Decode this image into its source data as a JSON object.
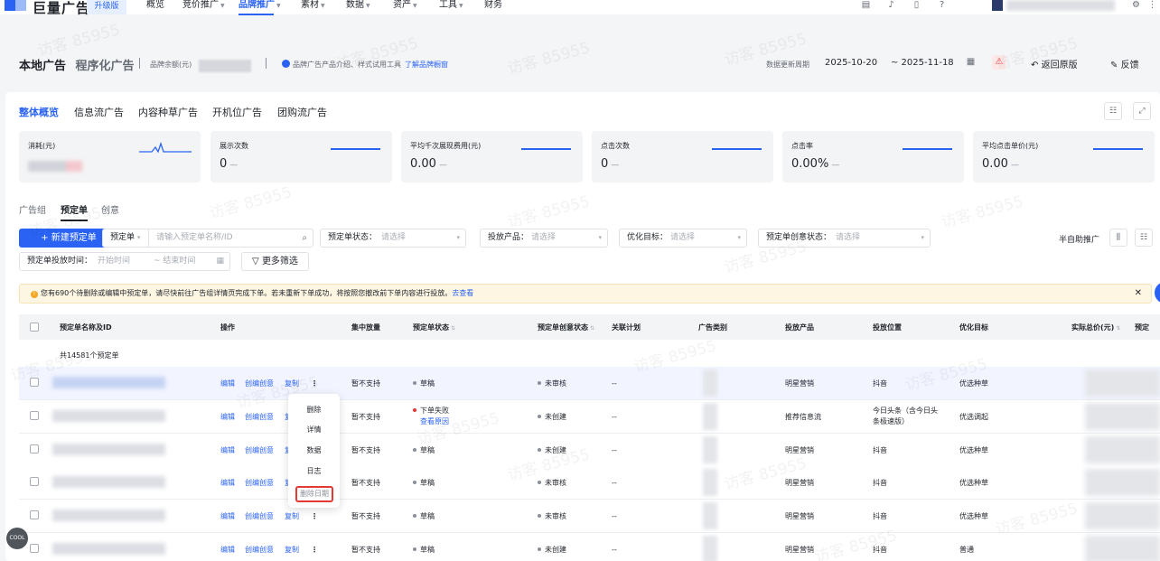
{
  "topnav": {
    "logo": "巨量广告",
    "badge": "升级版",
    "items": [
      {
        "label": "概览",
        "caret": false
      },
      {
        "label": "竞价推广",
        "caret": true
      },
      {
        "label": "品牌推广",
        "caret": true,
        "active": true
      },
      {
        "label": "素材",
        "caret": true
      },
      {
        "label": "数据",
        "caret": true
      },
      {
        "label": "资产",
        "caret": true
      },
      {
        "label": "工具",
        "caret": true
      },
      {
        "label": "财务",
        "caret": false
      }
    ],
    "caret_glyph": "▼"
  },
  "header": {
    "title": "本地广告",
    "subtitle": "程序化广告",
    "balance_label": "品牌余额(元)",
    "promo_text": "品牌广告产品介绍、样式试用工具",
    "promo_link": "了解品牌橱窗",
    "date_label": "数据更新周期",
    "date_start": "2025-10-20",
    "date_end": "~ 2025-11-18",
    "back_label": "返回原版",
    "feedback_label": "反馈"
  },
  "tabs": [
    "整体概览",
    "信息流广告",
    "内容种草广告",
    "开机位广告",
    "团购流广告"
  ],
  "metrics": [
    {
      "label": "消耗(元)",
      "value": "",
      "suffix": ""
    },
    {
      "label": "展示次数",
      "value": "0",
      "suffix": "—"
    },
    {
      "label": "平均千次展现费用(元)",
      "value": "0.00",
      "suffix": "—"
    },
    {
      "label": "点击次数",
      "value": "0",
      "suffix": "—"
    },
    {
      "label": "点击率",
      "value": "0.00%",
      "suffix": "—"
    },
    {
      "label": "平均点击单价(元)",
      "value": "0.00",
      "suffix": "—"
    }
  ],
  "subtabs": [
    "广告组",
    "预定单",
    "创意"
  ],
  "toolbar": {
    "new_button": "+ 新建预定单",
    "select_value": "预定单",
    "search_placeholder": "请输入预定单名称/ID",
    "filter_status_label": "预定单状态：",
    "filter_product_label": "投放产品：",
    "filter_goal_label": "优化目标：",
    "filter_creative_label": "预定单创意状态：",
    "placeholder": "请选择",
    "semi_auto": "半自助推广",
    "time_label": "预定单投放时间：",
    "time_start": "开始时间",
    "time_end": "~ 结束时间",
    "more_filters": "更多筛选"
  },
  "notice": {
    "text": "您有690个待删除或编辑中预定单，请尽快前往广告组详情页完成下单。若未重新下单成功，将按照您撤改前下单内容进行投放。",
    "link": "去查看"
  },
  "table": {
    "headers": [
      "预定单名称及ID",
      "操作",
      "集中放量",
      "预定单状态",
      "预定单创意状态",
      "关联计划",
      "广告类别",
      "投放产品",
      "投放位置",
      "优化目标",
      "实际总价(元)",
      "预定"
    ],
    "total": "共14581个预定单",
    "actions": {
      "edit": "编辑",
      "creative": "创编创意",
      "copy": "复制",
      "more": "⋮"
    },
    "rows": [
      {
        "concentrate": "暂不支持",
        "status": "草稿",
        "status_color": "gray",
        "status_link": "",
        "creative": "未审核",
        "plan": "--",
        "product": "明星营销",
        "position": "抖音",
        "position2": "",
        "goal": "优选种草"
      },
      {
        "concentrate": "暂不支持",
        "status": "下单失败",
        "status_color": "red",
        "status_link": "查看原因",
        "creative": "未创建",
        "plan": "--",
        "product": "推荐信息流",
        "position": "今日头条（含今日头",
        "position2": "条极速版）",
        "goal": "优选调起"
      },
      {
        "concentrate": "暂不支持",
        "status": "草稿",
        "status_color": "gray",
        "status_link": "",
        "creative": "未创建",
        "plan": "--",
        "product": "明星营销",
        "position": "抖音",
        "position2": "",
        "goal": "优选种草"
      },
      {
        "concentrate": "暂不支持",
        "status": "草稿",
        "status_color": "gray",
        "status_link": "",
        "creative": "未审核",
        "plan": "--",
        "product": "明星营销",
        "position": "抖音",
        "position2": "",
        "goal": "优选种草"
      },
      {
        "concentrate": "暂不支持",
        "status": "草稿",
        "status_color": "gray",
        "status_link": "",
        "creative": "未审核",
        "plan": "--",
        "product": "明星营销",
        "position": "抖音",
        "position2": "",
        "goal": "优选种草"
      },
      {
        "concentrate": "暂不支持",
        "status": "草稿",
        "status_color": "gray",
        "status_link": "",
        "creative": "未创建",
        "plan": "--",
        "product": "明星营销",
        "position": "抖音",
        "position2": "",
        "goal": "普通"
      }
    ]
  },
  "dropdown": [
    "删除",
    "详情",
    "数据",
    "日志",
    "删除日期"
  ],
  "watermark": "访客 85955",
  "colors": {
    "accent": "#2a63f4",
    "danger": "#e53935",
    "warning_bg": "#fdf6e3"
  }
}
